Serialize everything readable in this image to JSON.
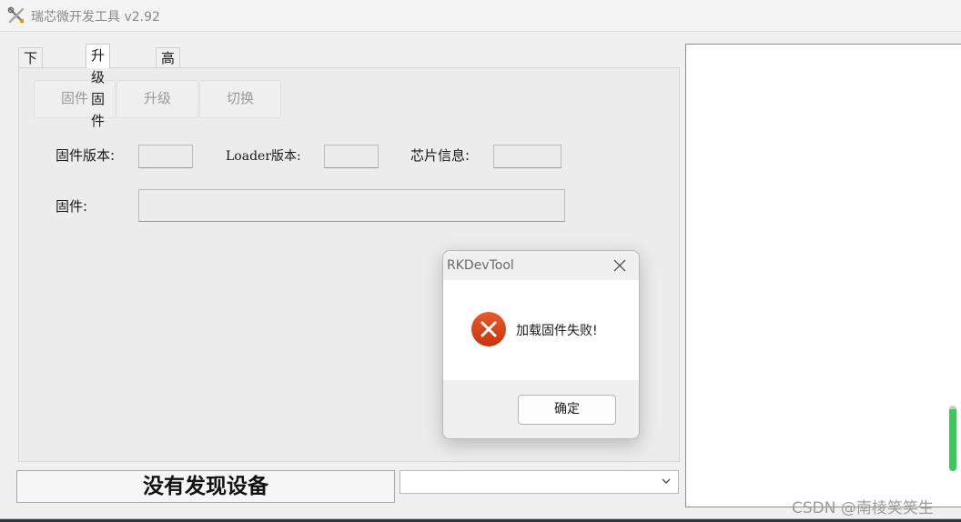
{
  "window": {
    "title": "瑞芯微开发工具 v2.92"
  },
  "tabs": [
    {
      "label": "下载镜像",
      "active": false
    },
    {
      "label": "升级固件",
      "active": true
    },
    {
      "label": "高级功能",
      "active": false
    }
  ],
  "toolbar": {
    "firmware_label": "固件",
    "upgrade_label": "升级",
    "switch_label": "切换"
  },
  "info": {
    "firmware_version_label": "固件版本:",
    "firmware_version_value": "",
    "loader_version_label": "Loader版本:",
    "loader_version_value": "",
    "chip_info_label": "芯片信息:",
    "chip_info_value": "",
    "firmware_path_label": "固件:",
    "firmware_path_value": ""
  },
  "status": {
    "text": "没有发现设备"
  },
  "device_select": {
    "value": ""
  },
  "log_panel": {
    "scroll_position": 0.95
  },
  "dialog": {
    "title": "RKDevTool",
    "message": "加载固件失败!",
    "ok_label": "确定",
    "icon": "error-icon",
    "icon_color": "#d8431c"
  },
  "watermark": "CSDN @南棱笑笑生",
  "colors": {
    "accent_green": "#3cc85a",
    "error_red": "#d8431c"
  }
}
